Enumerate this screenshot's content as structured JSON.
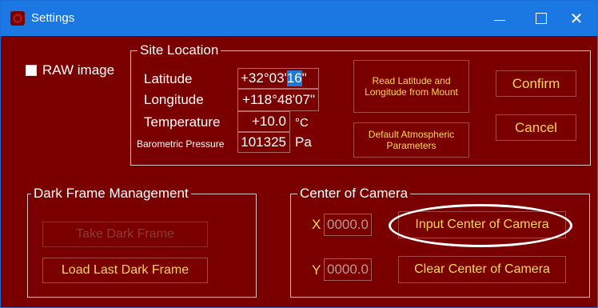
{
  "window": {
    "title": "Settings",
    "controls": {
      "minimize": "—",
      "maximize": "☐",
      "close": "✕"
    }
  },
  "raw_image": {
    "label": "RAW image",
    "checked": false
  },
  "site_location": {
    "title": "Site Location",
    "latitude_label": "Latitude",
    "latitude_prefix": "+32°03'",
    "latitude_selected": "16",
    "latitude_suffix": "\"",
    "longitude_label": "Longitude",
    "longitude_value": "+118°48'07\"",
    "temperature_label": "Temperature",
    "temperature_value": "+10.0",
    "temperature_unit": "°C",
    "pressure_label": "Barometric Pressure",
    "pressure_value": "101325",
    "pressure_unit": "Pa",
    "read_button": "Read Latitude and Longitude from Mount",
    "default_button": "Default Atmospheric Parameters"
  },
  "actions": {
    "confirm": "Confirm",
    "cancel": "Cancel"
  },
  "dark_frame": {
    "title": "Dark Frame Management",
    "take_button": "Take Dark Frame",
    "load_button": "Load Last Dark Frame"
  },
  "center_camera": {
    "title": "Center of Camera",
    "x_label": "X",
    "x_value": "0000.0",
    "y_label": "Y",
    "y_value": "0000.0",
    "input_button": "Input Center of Camera",
    "clear_button": "Clear Center of Camera"
  },
  "colors": {
    "background": "#7a0000",
    "titlebar": "#1b78e2",
    "button_text": "#ffd75a",
    "selection": "#1e7ad6"
  }
}
